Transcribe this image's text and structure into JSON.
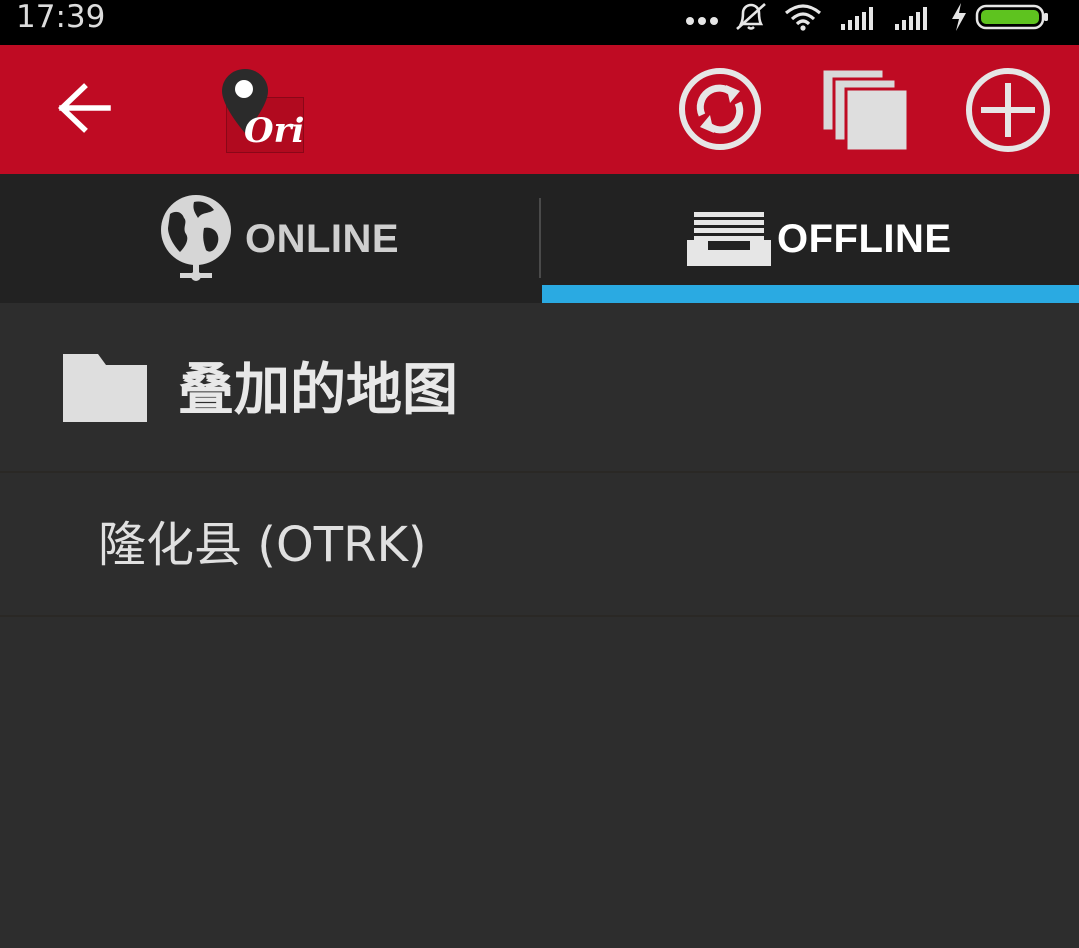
{
  "status_bar": {
    "time": "17:39",
    "icons": [
      "more-dots-icon",
      "alarm-muted-icon",
      "wifi-icon",
      "signal-icon",
      "signal-icon",
      "charging-bolt-icon",
      "battery-icon"
    ],
    "battery_color": "#5ec31f"
  },
  "toolbar": {
    "background": "#bf0b23",
    "logo_text": "Ori",
    "buttons": [
      "back-arrow-icon",
      "sync-icon",
      "layers-icon",
      "add-circle-icon"
    ]
  },
  "tabs": [
    {
      "label": "ONLINE",
      "icon": "globe-icon",
      "selected": false
    },
    {
      "label": "OFFLINE",
      "icon": "tray-icon",
      "selected": true
    }
  ],
  "tab_indicator_color": "#2aaae2",
  "content": {
    "folder": {
      "title": "叠加的地图",
      "icon": "folder-icon"
    },
    "items": [
      {
        "label": "隆化县 (OTRK)"
      }
    ]
  }
}
